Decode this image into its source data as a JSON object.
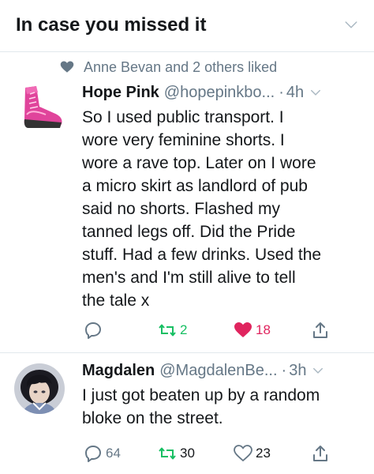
{
  "header": {
    "title": "In case you missed it",
    "chevron_icon": "chevron-down-icon"
  },
  "social_context": {
    "text": "Anne Bevan and 2 others liked",
    "icon": "heart-icon"
  },
  "tweets": [
    {
      "name": "Hope Pink",
      "handle": "@hopepinkbo...",
      "dot": "·",
      "time": "4h",
      "text": "So I used public transport. I\nwore very feminine shorts. I\nwore a rave top. Later on I wore\na micro skirt as landlord of pub\nsaid no shorts. Flashed my\ntanned legs off. Did the Pride\nstuff. Had a few drinks. Used the\nmen's and I'm still alive to tell\nthe tale x",
      "reply_count": "",
      "retweet_count": "2",
      "like_count": "18",
      "liked": true,
      "colors": {
        "retweet": "#17bf63",
        "like": "#e0245e",
        "icon": "#657786",
        "avatar_boot": "#e0449b"
      }
    },
    {
      "name": "Magdalen",
      "handle": "@MagdalenBe...",
      "dot": "·",
      "time": "3h",
      "text": "I just got beaten up by a random\nbloke on the street.",
      "reply_count": "64",
      "retweet_count": "30",
      "like_count": "23",
      "liked": false,
      "colors": {
        "retweet": "#17bf63",
        "like": "#657786",
        "icon": "#657786"
      }
    }
  ]
}
